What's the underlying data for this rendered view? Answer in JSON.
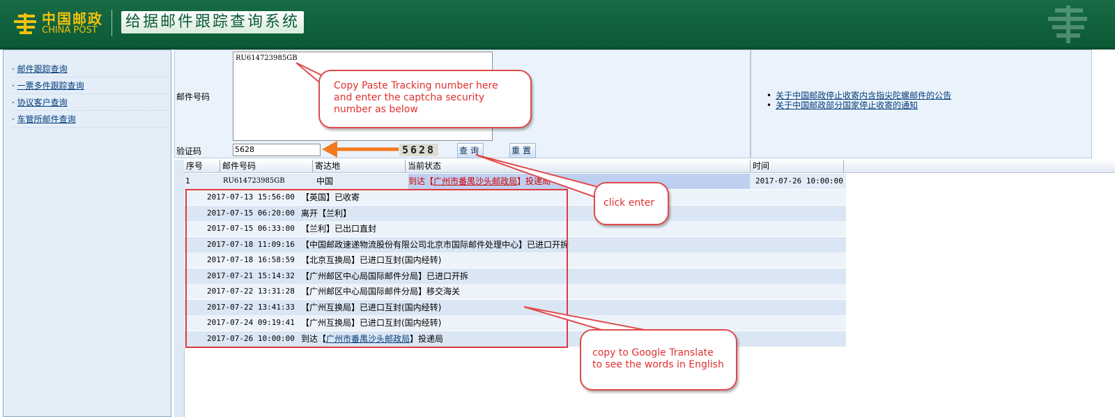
{
  "header": {
    "logo_cn": "中国邮政",
    "logo_en": "CHINA POST",
    "title": "给据邮件跟踪查询系统"
  },
  "sidebar": {
    "items": [
      {
        "label": "邮件跟踪查询"
      },
      {
        "label": "一票多件跟踪查询"
      },
      {
        "label": "协议客户查询"
      },
      {
        "label": "车管所邮件查询"
      }
    ]
  },
  "form": {
    "tracking_label": "邮件号码",
    "tracking_value": "RU614723985GB",
    "captcha_label": "验证码",
    "captcha_value": "5628",
    "captcha_image_text": "5628",
    "query_button": "查询",
    "reset_button": "重置"
  },
  "notices": [
    {
      "label": "关于中国邮政停止收寄内含指尖陀螺邮件的公告"
    },
    {
      "label": "关于中国邮政部分国家停止收寄的通知"
    }
  ],
  "grid": {
    "headers": [
      "序号",
      "邮件号码",
      "寄达地",
      "当前状态",
      "时间"
    ],
    "main_row": {
      "index": "1",
      "number": "RU614723985GB",
      "destination": "中国",
      "status_prefix": "到达【",
      "status_link": "广州市番禺沙头邮政局",
      "status_suffix": "】投递局",
      "time": "2017-07-26  10:00:00"
    },
    "events": [
      {
        "time": "2017-07-13 15:56:00",
        "desc": "【英国】已收寄"
      },
      {
        "time": "2017-07-15 06:20:00",
        "desc": "离开【兰利】"
      },
      {
        "time": "2017-07-15 06:33:00",
        "desc": "【兰利】已出口直封"
      },
      {
        "time": "2017-07-18 11:09:16",
        "desc": "【中国邮政速递物流股份有限公司北京市国际邮件处理中心】已进口开拆"
      },
      {
        "time": "2017-07-18 16:58:59",
        "desc": "【北京互换局】已进口互封(国内经转)"
      },
      {
        "time": "2017-07-21 15:14:32",
        "desc": "【广州邮区中心局国际邮件分局】已进口开拆"
      },
      {
        "time": "2017-07-22 13:31:28",
        "desc": "【广州邮区中心局国际邮件分局】移交海关"
      },
      {
        "time": "2017-07-22 13:41:33",
        "desc": "【广州互换局】已进口互封(国内经转)"
      },
      {
        "time": "2017-07-24 09:19:41",
        "desc": "【广州互换局】已进口互封(国内经转)"
      }
    ],
    "last_event": {
      "time": "2017-07-26 10:00:00",
      "prefix": "到达【",
      "link": "广州市番禺沙头邮政局",
      "suffix": "】投递局"
    }
  },
  "annotations": {
    "paste": "Copy Paste Tracking number here and enter the captcha security number as below",
    "enter": "click enter",
    "translate": "copy to Google Translate to see the words in English"
  },
  "colors": {
    "header_green": "#0b5a35",
    "logo_yellow": "#f4c20d",
    "callout_red": "#e03a3a",
    "arrow_orange": "#f47a20"
  }
}
